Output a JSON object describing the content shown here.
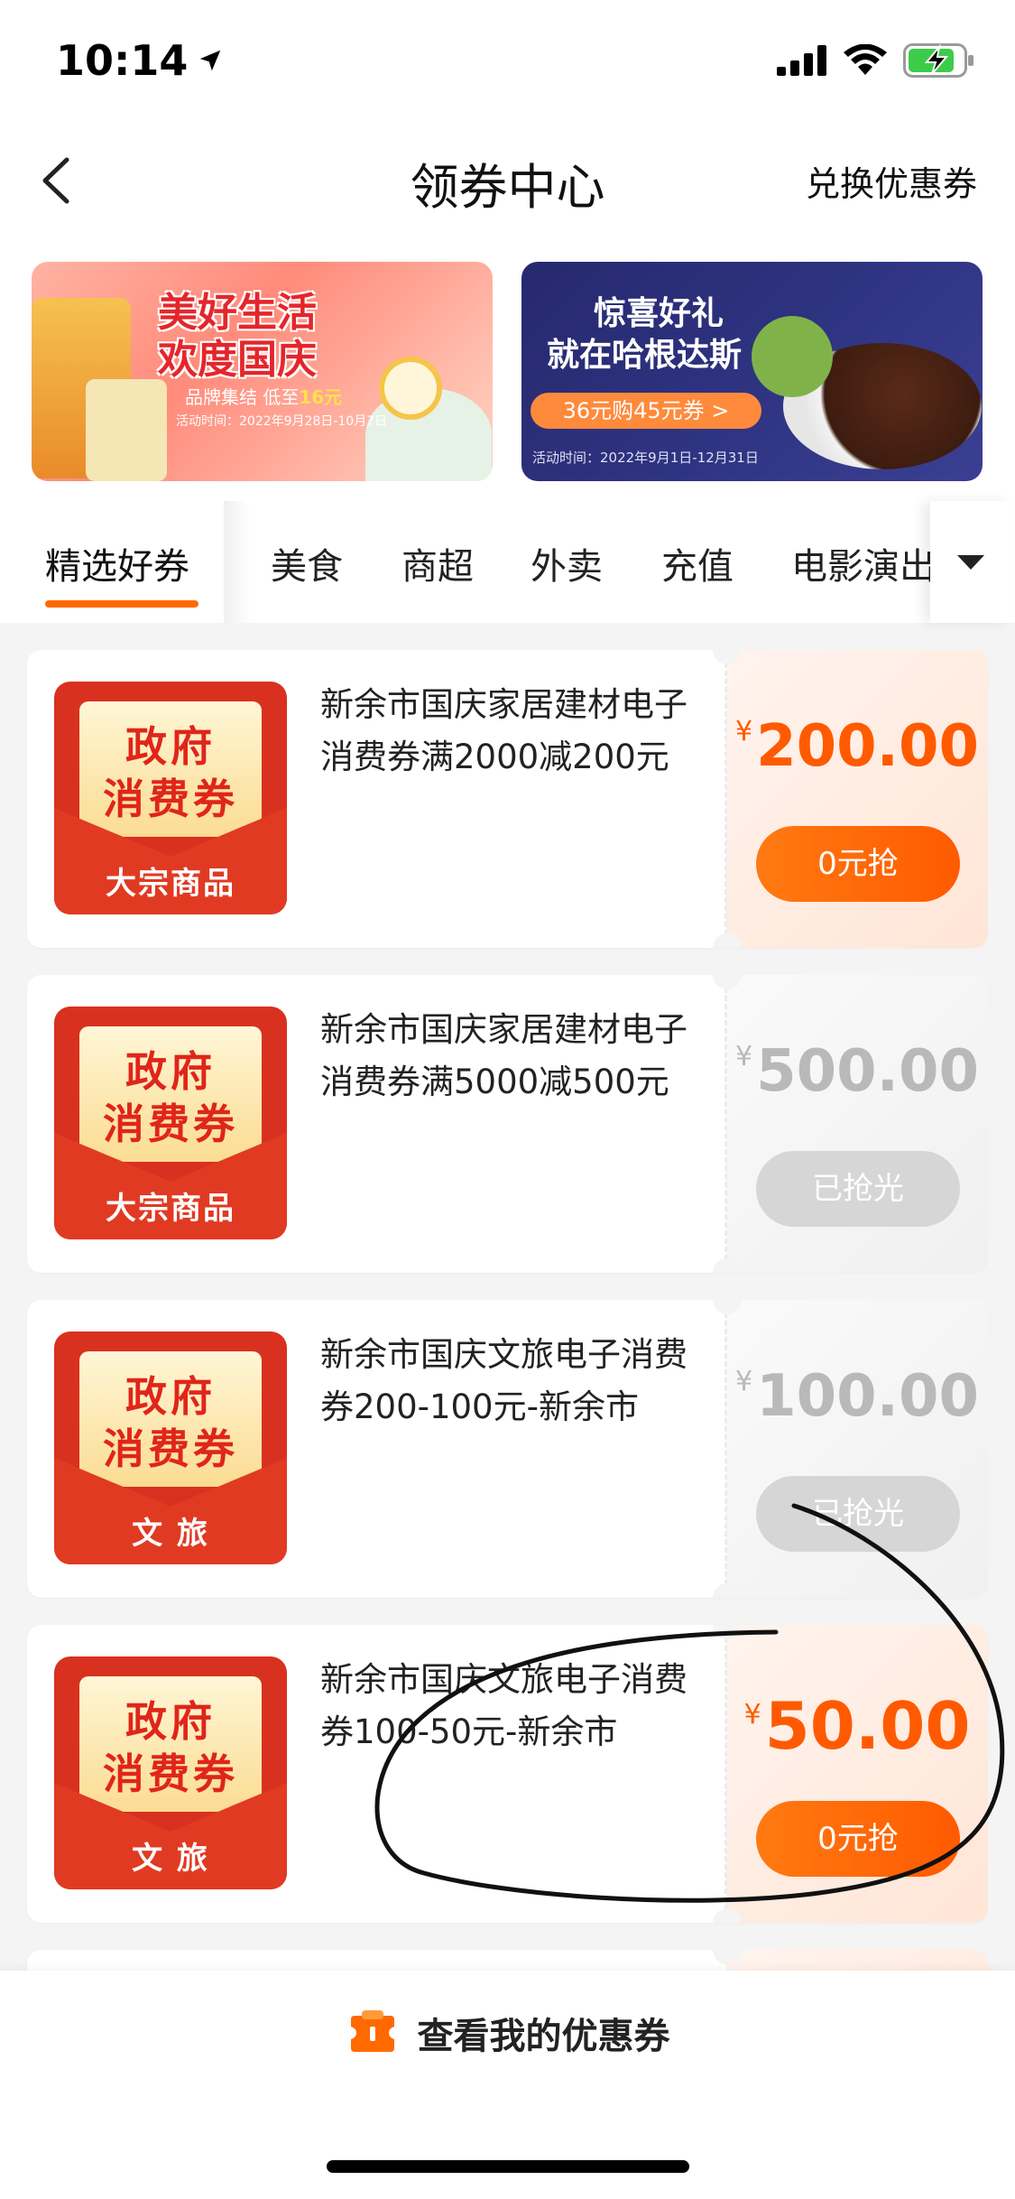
{
  "status_bar": {
    "time": "10:14"
  },
  "nav": {
    "title": "领券中心",
    "action": "兑换优惠券"
  },
  "banners": [
    {
      "title_line1": "美好生活",
      "title_line2": "欢度国庆",
      "subtitle": "品牌集结 低至",
      "subtitle_highlight": "16元",
      "date": "活动时间：2022年9月28日-10月7日"
    },
    {
      "title_line1": "惊喜好礼",
      "title_line2": "就在哈根达斯",
      "pill": "36元购45元券 >",
      "date": "活动时间：2022年9月1日-12月31日"
    }
  ],
  "tabs": [
    {
      "label": "精选好券",
      "active": true
    },
    {
      "label": "美食",
      "active": false
    },
    {
      "label": "商超",
      "active": false
    },
    {
      "label": "外卖",
      "active": false
    },
    {
      "label": "充值",
      "active": false
    },
    {
      "label": "电影演出",
      "active": false
    }
  ],
  "badge": {
    "line1": "政府",
    "line2": "消费券"
  },
  "coupons": [
    {
      "category": "大宗商品",
      "title": "新余市国庆家居建材电子消费券满2000减200元",
      "currency": "¥",
      "amount": "200.00",
      "button": "0元抢",
      "state": "active"
    },
    {
      "category": "大宗商品",
      "title": "新余市国庆家居建材电子消费券满5000减500元",
      "currency": "¥",
      "amount": "500.00",
      "button": "已抢光",
      "state": "sold"
    },
    {
      "category": "文 旅",
      "title": "新余市国庆文旅电子消费券200-100元-新余市",
      "currency": "¥",
      "amount": "100.00",
      "button": "已抢光",
      "state": "sold"
    },
    {
      "category": "文 旅",
      "title": "新余市国庆文旅电子消费券100-50元-新余市",
      "currency": "¥",
      "amount": "50.00",
      "button": "0元抢",
      "state": "active"
    }
  ],
  "bottom": {
    "my_coupons": "查看我的优惠券"
  },
  "colors": {
    "accent": "#ff5a00",
    "badge_red": "#d8311f",
    "sold_gray": "#d6d6d6",
    "banner2_navy": "#2c2f7c"
  }
}
